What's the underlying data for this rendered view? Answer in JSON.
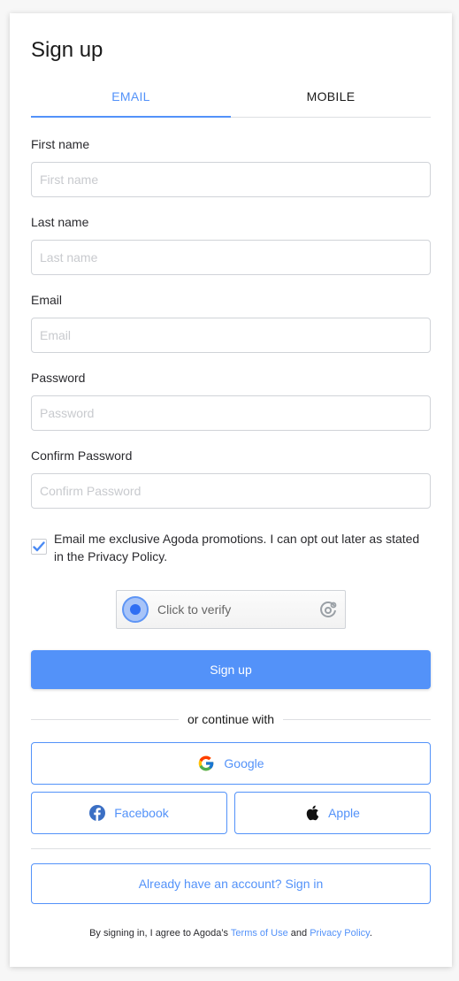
{
  "title": "Sign up",
  "tabs": [
    {
      "label": "EMAIL",
      "active": true
    },
    {
      "label": "MOBILE",
      "active": false
    }
  ],
  "fields": {
    "first_name": {
      "label": "First name",
      "placeholder": "First name",
      "value": ""
    },
    "last_name": {
      "label": "Last name",
      "placeholder": "Last name",
      "value": ""
    },
    "email": {
      "label": "Email",
      "placeholder": "Email",
      "value": ""
    },
    "password": {
      "label": "Password",
      "placeholder": "Password",
      "value": ""
    },
    "confirm_password": {
      "label": "Confirm Password",
      "placeholder": "Confirm Password",
      "value": ""
    }
  },
  "promo": {
    "checked": true,
    "text": "Email me exclusive Agoda promotions. I can opt out later as stated in the Privacy Policy."
  },
  "captcha": {
    "label": "Click to verify"
  },
  "signup_button": "Sign up",
  "divider_text": "or continue with",
  "social": {
    "google": "Google",
    "facebook": "Facebook",
    "apple": "Apple"
  },
  "signin_button": "Already have an account? Sign in",
  "legal": {
    "prefix": "By signing in, I agree to Agoda’s ",
    "terms": "Terms of Use",
    "middle": " and ",
    "privacy": "Privacy Policy",
    "suffix": "."
  },
  "colors": {
    "accent": "#5392f9",
    "background": "#f7f7f7"
  }
}
